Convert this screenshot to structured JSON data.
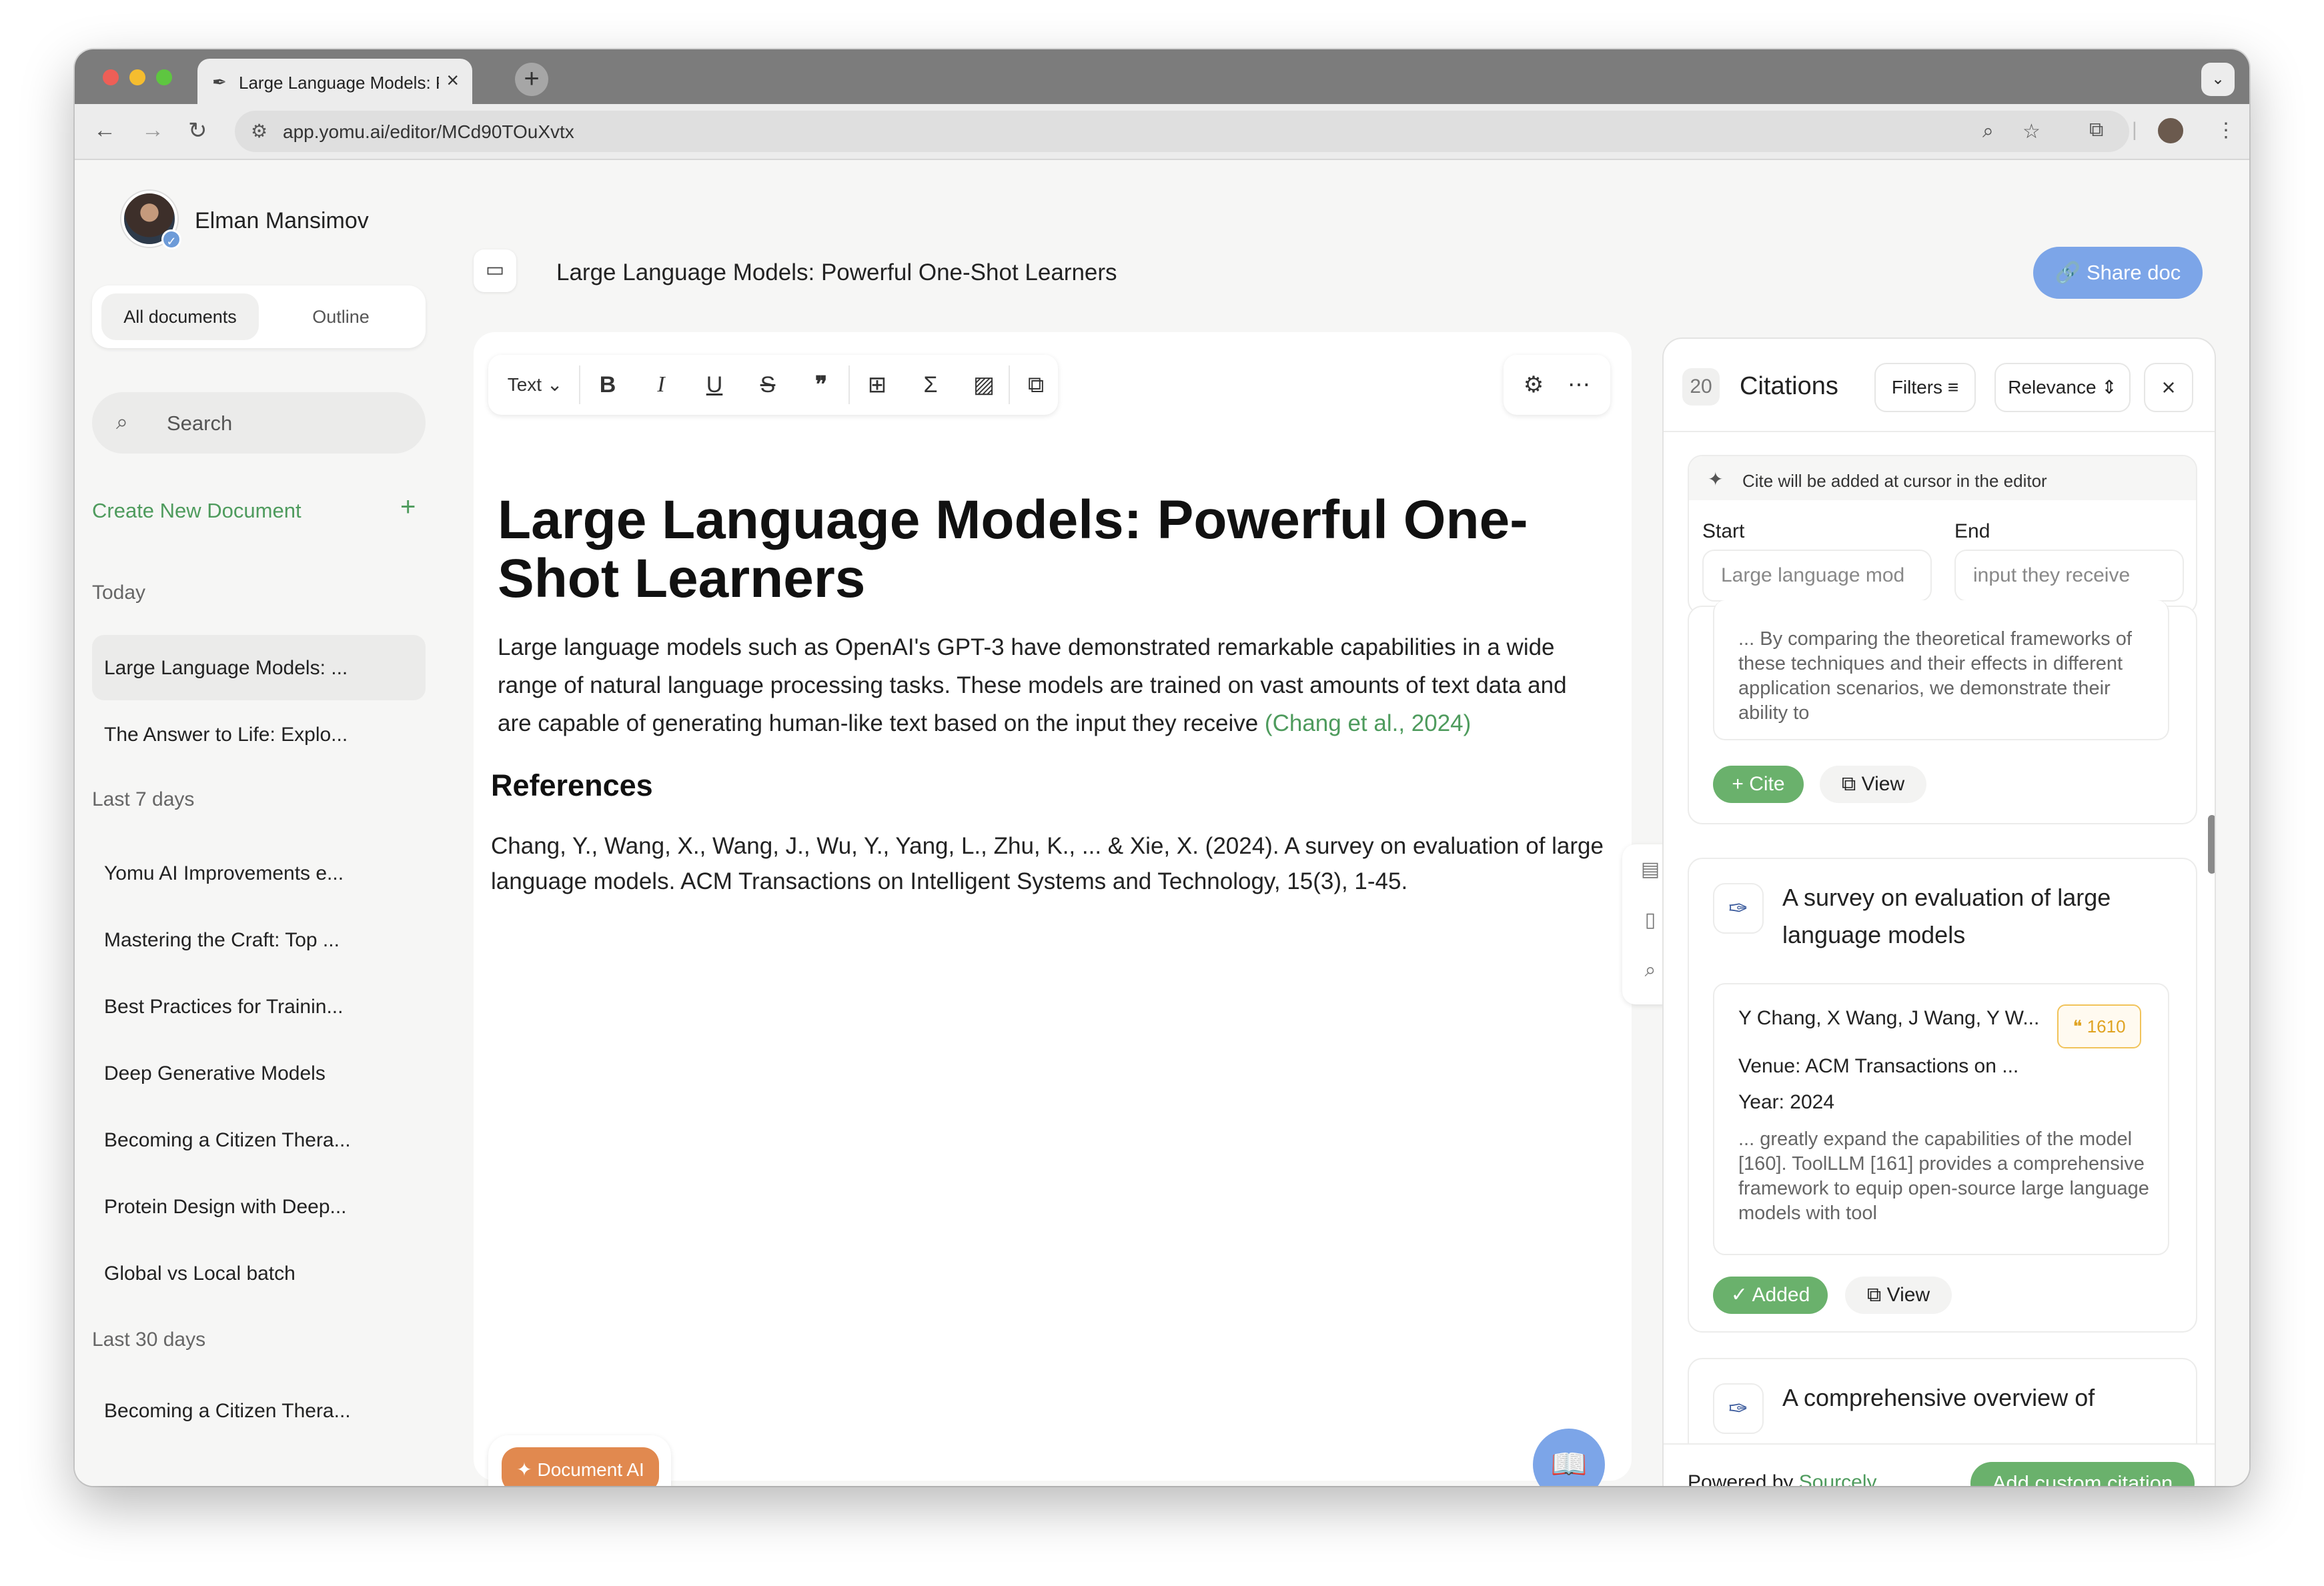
{
  "browser": {
    "tab_title": "Large Language Models: Pow",
    "url": "app.yomu.ai/editor/MCd90TOuXvtx"
  },
  "user": {
    "name": "Elman Mansimov"
  },
  "sidebar": {
    "tabs": [
      "All documents",
      "Outline"
    ],
    "search_placeholder": "Search",
    "create_label": "Create New Document",
    "groups": [
      {
        "label": "Today",
        "items": [
          "Large Language Models: ...",
          "The Answer to Life: Explo..."
        ]
      },
      {
        "label": "Last 7 days",
        "items": [
          "Yomu AI Improvements e...",
          "Mastering the Craft: Top ...",
          "Best Practices for Trainin...",
          "Deep Generative Models",
          "Becoming a Citizen Thera...",
          "Protein Design with Deep...",
          "Global vs Local batch"
        ]
      },
      {
        "label": "Last 30 days",
        "items": [
          "Becoming a Citizen Thera..."
        ]
      }
    ]
  },
  "header": {
    "title": "Large Language Models: Powerful One-Shot Learners",
    "share_label": "Share doc"
  },
  "editor": {
    "text_style": "Text",
    "heading": "Large Language Models: Powerful One-Shot Learners",
    "paragraph": "Large language models such as OpenAI's GPT-3 have demonstrated remarkable capabilities in a wide range of natural language processing tasks. These models are trained on vast amounts of text data and are capable of generating human-like text based on the input they receive",
    "citation": "(Chang et al., 2024)",
    "references_heading": "References",
    "reference": "Chang, Y., Wang, X., Wang, J., Wu, Y., Yang, L., Zhu, K., ... & Xie, X. (2024). A survey on evaluation of large language models. ACM Transactions on Intelligent Systems and Technology, 15(3), 1-45.",
    "doc_ai_label": "Document AI"
  },
  "citations": {
    "count": "20",
    "title": "Citations",
    "filters_label": "Filters",
    "sort_label": "Relevance",
    "cursor_note": "Cite will be added at cursor in the editor",
    "start_label": "Start",
    "end_label": "End",
    "start_value": "Large language mod",
    "end_value": "input they receive",
    "first_excerpt": "... By comparing the theoretical frameworks of these techniques and their effects in different application scenarios, we demonstrate their ability to",
    "cite_label": "Cite",
    "view_label": "View",
    "card": {
      "title": "A survey on evaluation of large language models",
      "authors": "Y Chang, X Wang, J Wang, Y W...",
      "cites": "1610",
      "venue_label": "Venue:",
      "venue": "ACM Transactions on ...",
      "year_label": "Year:",
      "year": "2024",
      "excerpt": "... greatly expand the capabilities of the model [160]. ToolLLM [161] provides a comprehensive framework to equip open-source large language models with tool",
      "added_label": "Added",
      "view_label": "View"
    },
    "next_title": "A comprehensive overview of",
    "powered_prefix": "Powered by",
    "powered_brand": "Sourcely",
    "add_custom_label": "Add custom citation"
  }
}
